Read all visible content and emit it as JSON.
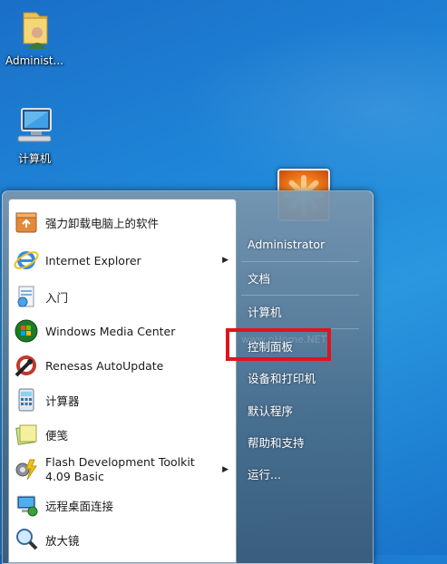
{
  "desktop": {
    "icons": [
      {
        "label": "Administ...",
        "icon": "user-folder-icon"
      },
      {
        "label": "计算机",
        "icon": "computer-icon"
      }
    ]
  },
  "start_menu": {
    "programs": [
      {
        "label": "强力卸载电脑上的软件",
        "icon": "uninstall-icon",
        "has_submenu": false
      },
      {
        "label": "Internet Explorer",
        "icon": "internet-explorer-icon",
        "has_submenu": true
      },
      {
        "label": "入门",
        "icon": "getting-started-icon",
        "has_submenu": false
      },
      {
        "label": "Windows Media Center",
        "icon": "media-center-icon",
        "has_submenu": false
      },
      {
        "label": "Renesas AutoUpdate",
        "icon": "renesas-update-icon",
        "has_submenu": false
      },
      {
        "label": "计算器",
        "icon": "calculator-icon",
        "has_submenu": false
      },
      {
        "label": "便笺",
        "icon": "sticky-notes-icon",
        "has_submenu": false
      },
      {
        "label_line1": "Flash Development Toolkit",
        "label_line2": "4.09 Basic",
        "icon": "flash-toolkit-icon",
        "has_submenu": true
      },
      {
        "label": "远程桌面连接",
        "icon": "remote-desktop-icon",
        "has_submenu": false
      },
      {
        "label": "放大镜",
        "icon": "magnifier-icon",
        "has_submenu": false
      }
    ],
    "submenu_arrow": "▶",
    "places": [
      {
        "label": "Administrator"
      },
      {
        "label": "文档"
      },
      {
        "label": "计算机"
      },
      {
        "label": "控制面板"
      },
      {
        "label": "设备和打印机"
      },
      {
        "label": "默认程序"
      },
      {
        "label": "帮助和支持"
      },
      {
        "label": "运行..."
      }
    ],
    "watermark": "www.pHome.NET"
  },
  "colors": {
    "highlight": "#e0141e",
    "desktop_blue": "#1f86d8"
  }
}
